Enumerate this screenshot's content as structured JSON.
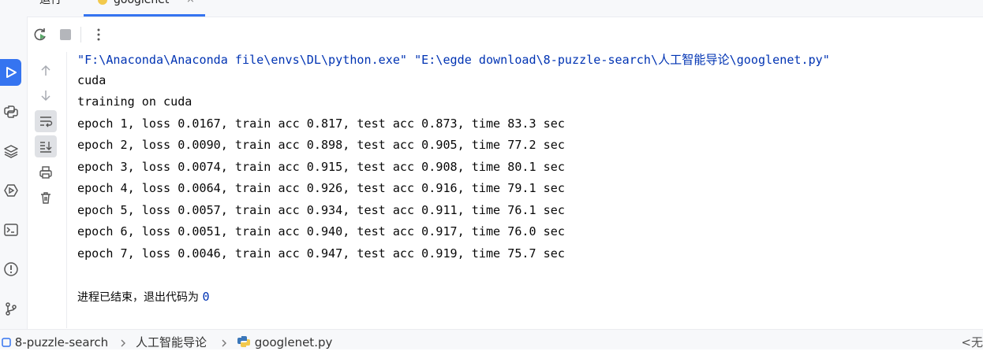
{
  "tabs": {
    "run_label": "运行",
    "file_label": "googlenet",
    "close_symbol": "×"
  },
  "console": {
    "command": "\"F:\\Anaconda\\Anaconda file\\envs\\DL\\python.exe\" \"E:\\egde download\\8-puzzle-search\\人工智能导论\\googlenet.py\"",
    "lines": [
      "cuda",
      "training on cuda",
      "epoch 1, loss 0.0167, train acc 0.817, test acc 0.873, time 83.3 sec",
      "epoch 2, loss 0.0090, train acc 0.898, test acc 0.905, time 77.2 sec",
      "epoch 3, loss 0.0074, train acc 0.915, test acc 0.908, time 80.1 sec",
      "epoch 4, loss 0.0064, train acc 0.926, test acc 0.916, time 79.1 sec",
      "epoch 5, loss 0.0057, train acc 0.934, test acc 0.911, time 76.1 sec",
      "epoch 6, loss 0.0051, train acc 0.940, test acc 0.917, time 76.0 sec",
      "epoch 7, loss 0.0046, train acc 0.947, test acc 0.919, time 75.7 sec"
    ],
    "exit_text": "进程已结束，退出代码为 ",
    "exit_code": "0"
  },
  "statusbar": {
    "project": "8-puzzle-search",
    "folder": "人工智能导论",
    "file": "googlenet.py",
    "right_text": "<无"
  },
  "colors": {
    "accent": "#3574f0",
    "command_text": "#0033b3"
  }
}
